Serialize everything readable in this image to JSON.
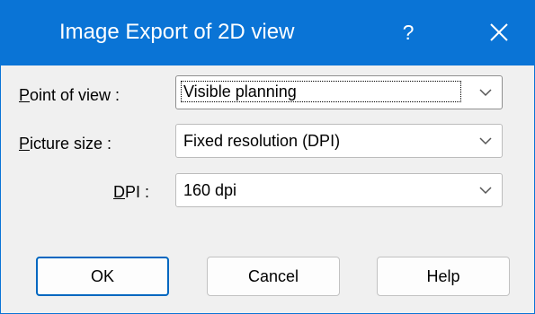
{
  "window": {
    "title": "Image Export of 2D view",
    "help_glyph": "?",
    "colors": {
      "titlebar": "#0a74d6",
      "title_text": "#ffffff",
      "dialog_bg": "#f0f0f0",
      "default_button_border": "#0067c0"
    }
  },
  "form": {
    "point_of_view": {
      "label": "Point of view :",
      "value": "Visible planning"
    },
    "picture_size": {
      "label": "Picture size :",
      "value": "Fixed resolution (DPI)"
    },
    "dpi": {
      "label": "DPI :",
      "value": "160 dpi"
    }
  },
  "buttons": {
    "ok": "OK",
    "cancel": "Cancel",
    "help": "Help"
  },
  "icons": {
    "help": "question-mark-icon",
    "close": "close-icon",
    "dropdown": "chevron-down-icon"
  }
}
